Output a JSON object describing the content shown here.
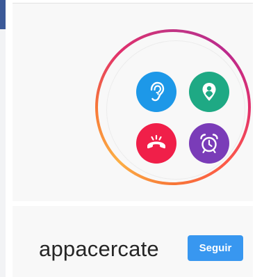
{
  "profile": {
    "username": "appacercate",
    "follow_label": "Seguir"
  },
  "avatar": {
    "icons": [
      "ear-icon",
      "location-pin-icon",
      "hang-up-phone-icon",
      "alarm-clock-icon"
    ],
    "colors": {
      "ear": "#1d98e8",
      "pin": "#1ea984",
      "phone": "#f01f49",
      "alarm": "#7a3cb8",
      "story_ring": [
        "#c13584",
        "#e1306c",
        "#fd5949",
        "#f77737",
        "#fcaf45"
      ]
    }
  },
  "colors": {
    "follow_button": "#3897f0",
    "card_background": "#f8f8f8"
  }
}
